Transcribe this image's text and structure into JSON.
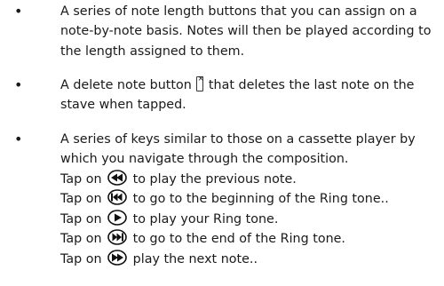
{
  "bullets": [
    {
      "lines": [
        "A series of note length buttons that you can assign on a",
        "note-by-note basis. Notes will then be played according to",
        "the length assigned to them."
      ]
    },
    {
      "line1_before_icon": "A delete note button",
      "line1_after_icon": " that deletes the last note on the",
      "line2": "stave when tapped.",
      "icon": "delete-note-icon"
    },
    {
      "lines": [
        "A series of keys similar to those on a cassette player by",
        "which you navigate through the composition."
      ]
    }
  ],
  "tap_prefix": "Tap on",
  "tap_items": [
    {
      "icon": "previous-note-icon",
      "text": " to play the previous note."
    },
    {
      "icon": "go-to-beginning-icon",
      "text": " to go to the beginning of the Ring tone.."
    },
    {
      "icon": "play-icon",
      "text": " to play your Ring tone."
    },
    {
      "icon": "go-to-end-icon",
      "text": " to go to the end of the Ring tone."
    },
    {
      "icon": "next-note-icon",
      "text": " play the next note.."
    }
  ]
}
